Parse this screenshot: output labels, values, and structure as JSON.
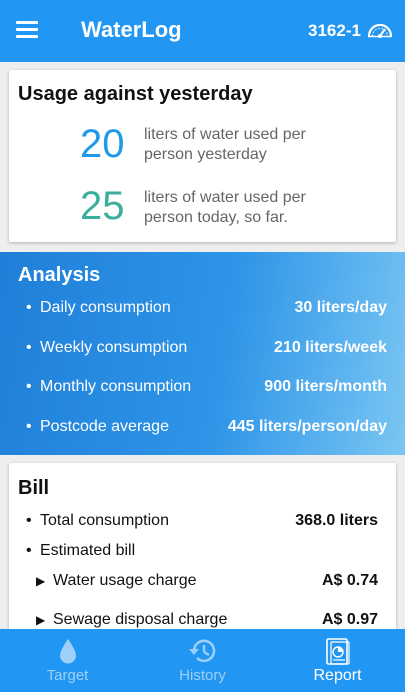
{
  "header": {
    "title": "WaterLog",
    "meter_id": "3162-1",
    "menu_icon": "hamburger-menu-icon",
    "meter_icon": "gauge-icon"
  },
  "usage": {
    "title": "Usage against yesterday",
    "yesterday_value": "20",
    "yesterday_desc": "liters of water used per person yesterday",
    "today_value": "25",
    "today_desc": "liters of water used per person today, so far.",
    "yesterday_color": "#1e9be8",
    "today_color": "#3aaf9c"
  },
  "analysis": {
    "title": "Analysis",
    "rows": [
      {
        "label": "Daily consumption",
        "value": "30 liters/day"
      },
      {
        "label": "Weekly consumption",
        "value": "210 liters/week"
      },
      {
        "label": "Monthly consumption",
        "value": "900 liters/month"
      },
      {
        "label": "Postcode average",
        "value": "445 liters/person/day"
      }
    ]
  },
  "bill": {
    "title": "Bill",
    "total_label": "Total consumption",
    "total_value": "368.0 liters",
    "estimated_label": "Estimated bill",
    "items": [
      {
        "label": "Water usage charge",
        "value": "A$ 0.74"
      },
      {
        "label": "Sewage disposal charge",
        "value": "A$ 0.97"
      }
    ]
  },
  "nav": {
    "items": [
      {
        "label": "Target",
        "icon": "water-drop-icon"
      },
      {
        "label": "History",
        "icon": "history-icon"
      },
      {
        "label": "Report",
        "icon": "report-icon"
      }
    ],
    "active": "Report",
    "active_color": "#ffffff",
    "inactive_color": "#9ecff8"
  },
  "colors": {
    "primary": "#2196f3",
    "background": "#eeeeee"
  }
}
